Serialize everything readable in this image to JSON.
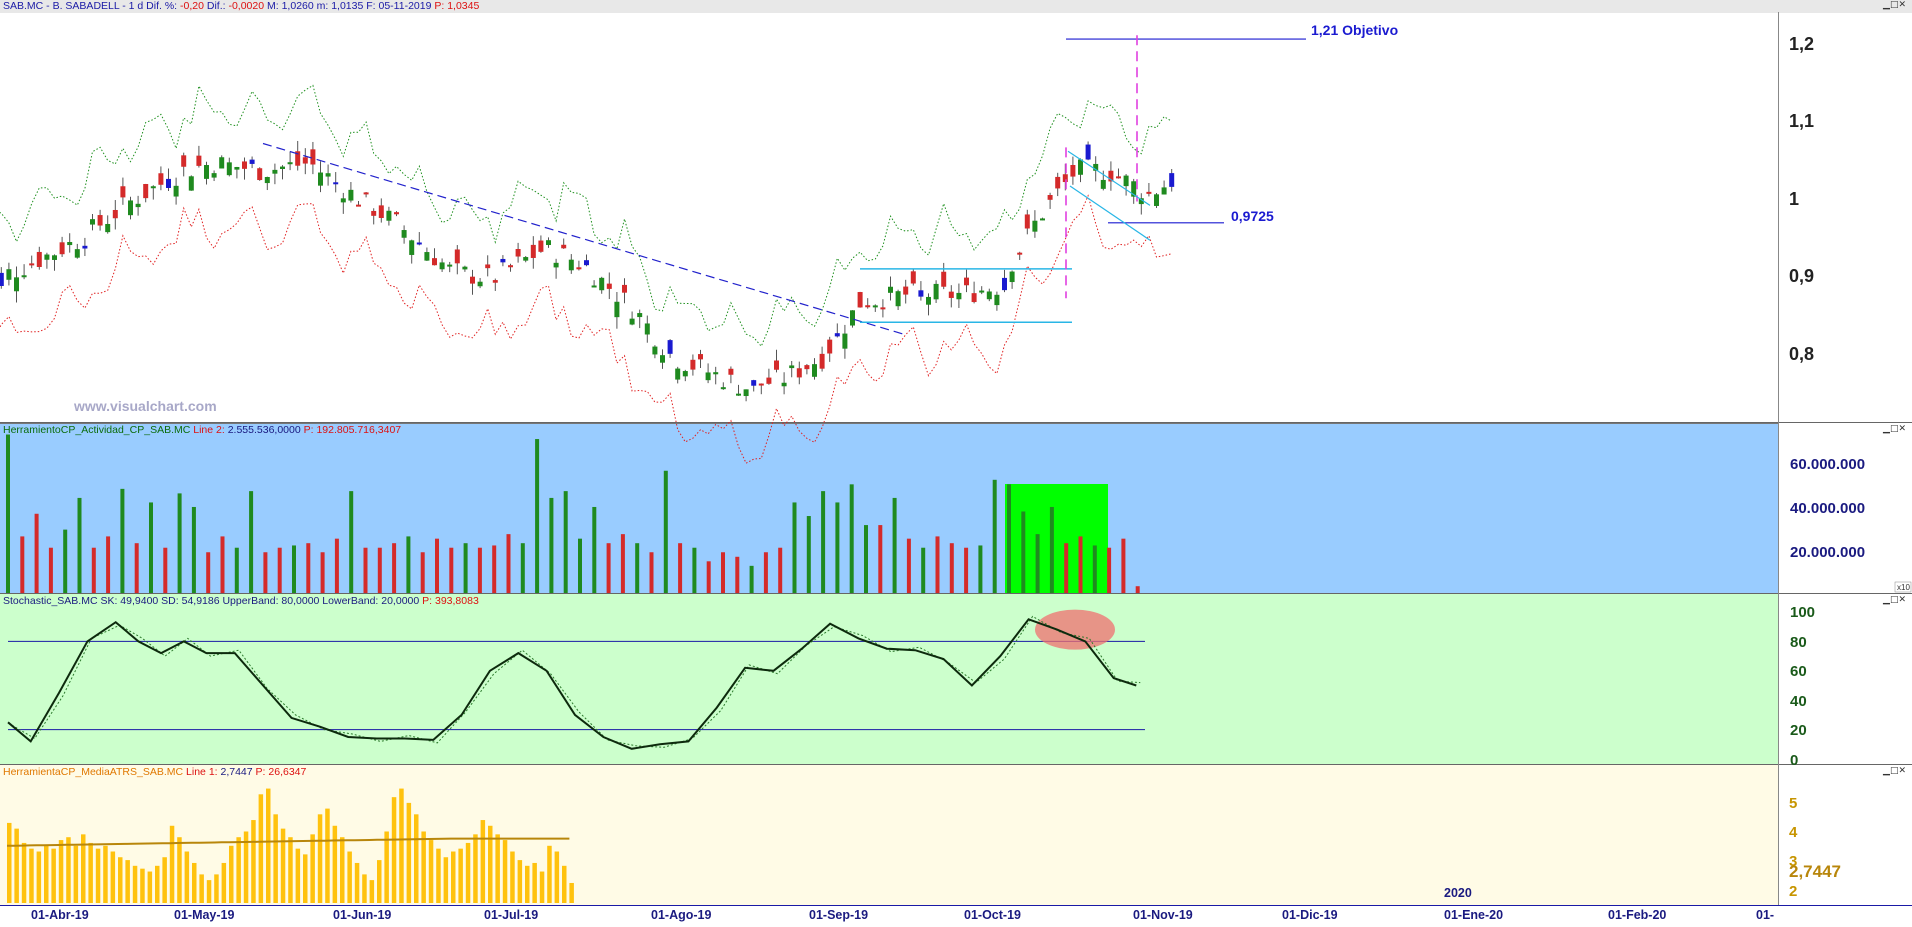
{
  "colors": {
    "up": "#1f8a1f",
    "down": "#d42a2a",
    "blue_candle": "#1a1ad0",
    "volume_bg": "#99ccff",
    "stoch_bg": "#ccffcc",
    "atr_bg": "#fffbe6",
    "atr_bar": "#ffc20e",
    "upper_band": "#1d8f1d",
    "lower_band": "#e02020"
  },
  "panel_main": {
    "title_parts": {
      "symbol": "SAB.MC - B. SABADELL -  1 d  Dif. %:",
      "dif_pct": "-0,20",
      "dif_label": "Dif.:",
      "dif": "-0,0020",
      "rest": "M: 1,0260  m: 1,0135  F: 05-11-2019",
      "p_label": "P:",
      "p_value": "1,0345"
    },
    "watermark": "www.visualchart.com",
    "annotations": {
      "objetivo": "1,21 Objetivo",
      "support": "0,9725"
    }
  },
  "panel_volume": {
    "name": "HerramientoCP_Actividad_CP_SAB.MC",
    "line_label": "Line 2:",
    "line_value": "2.555.536,0000",
    "p_label": "P:",
    "p_value": "192.805.716,3407",
    "axis_badge": "x10"
  },
  "panel_stoch": {
    "name": "Stochastic_SAB.MC",
    "values": "SK: 49,9400  SD: 54,9186  UpperBand: 80,0000  LowerBand: 20,0000",
    "p_label": "P:",
    "p_value": "393,8083"
  },
  "panel_atr": {
    "name": "HerramientaCP_MediaATRS_SAB.MC",
    "line_label": "Line 1:",
    "line_value": "2,7447",
    "p_label": "P:",
    "p_value": "26,6347",
    "last_value": "2,7447"
  },
  "x_axis": {
    "labels": [
      "01-Abr-19",
      "01-May-19",
      "01-Jun-19",
      "01-Jul-19",
      "01-Ago-19",
      "01-Sep-19",
      "01-Oct-19",
      "01-Nov-19",
      "01-Dic-19",
      "01-Ene-20",
      "01-Feb-20",
      "01-"
    ],
    "year_label": "2020"
  },
  "chart_data": [
    {
      "type": "candlestick",
      "title": "SAB.MC - B. SABADELL - 1 d",
      "y_ticks": [
        0.8,
        0.9,
        1.0,
        1.1,
        1.2
      ],
      "y_tick_labels": [
        "0,8",
        "0,9",
        "1",
        "1,1",
        "1,2"
      ],
      "ylim": [
        0.715,
        1.245
      ],
      "x_range": [
        "2019-03-22",
        "2019-11-05"
      ],
      "series_points_close": [
        [
          "2019-03-22",
          0.89
        ],
        [
          "2019-04-01",
          0.92
        ],
        [
          "2019-04-10",
          0.95
        ],
        [
          "2019-04-20",
          1.0
        ],
        [
          "2019-04-30",
          1.04
        ],
        [
          "2019-05-06",
          1.05
        ],
        [
          "2019-05-15",
          1.04
        ],
        [
          "2019-05-24",
          1.05
        ],
        [
          "2019-06-01",
          1.01
        ],
        [
          "2019-06-10",
          0.97
        ],
        [
          "2019-06-20",
          0.91
        ],
        [
          "2019-06-28",
          0.9
        ],
        [
          "2019-07-08",
          0.94
        ],
        [
          "2019-07-15",
          0.92
        ],
        [
          "2019-07-25",
          0.86
        ],
        [
          "2019-08-01",
          0.8
        ],
        [
          "2019-08-08",
          0.78
        ],
        [
          "2019-08-15",
          0.76
        ],
        [
          "2019-08-22",
          0.77
        ],
        [
          "2019-08-30",
          0.8
        ],
        [
          "2019-09-06",
          0.87
        ],
        [
          "2019-09-15",
          0.88
        ],
        [
          "2019-09-25",
          0.88
        ],
        [
          "2019-10-02",
          0.89
        ],
        [
          "2019-10-10",
          0.98
        ],
        [
          "2019-10-17",
          1.04
        ],
        [
          "2019-10-23",
          1.04
        ],
        [
          "2019-10-31",
          1.01
        ],
        [
          "2019-11-05",
          1.03
        ]
      ],
      "annotations": [
        {
          "text": "1,21 Objetivo",
          "y": 1.21
        },
        {
          "text": "0,9725",
          "y": 0.9725
        }
      ]
    },
    {
      "type": "bar",
      "title": "HerramientoCP_Actividad_CP_SAB.MC",
      "y_tick_labels": [
        "20.000.000",
        "40.000.000",
        "60.000.000"
      ],
      "ylim": [
        0,
        72000000
      ],
      "values_approx": [
        70000000,
        25000000,
        35000000,
        20000000,
        28000000,
        42000000,
        20000000,
        25000000,
        46000000,
        22000000,
        40000000,
        20000000,
        44000000,
        38000000,
        18000000,
        25000000,
        20000000,
        45000000,
        18000000,
        20000000,
        21000000,
        22000000,
        18000000,
        24000000,
        45000000,
        20000000,
        20000000,
        22000000,
        25000000,
        18000000,
        24000000,
        20000000,
        22000000,
        20000000,
        21000000,
        26000000,
        22000000,
        68000000,
        42000000,
        45000000,
        24000000,
        38000000,
        22000000,
        26000000,
        22000000,
        18000000,
        54000000,
        22000000,
        20000000,
        14000000,
        18000000,
        16000000,
        12000000,
        18000000,
        20000000,
        40000000,
        34000000,
        45000000,
        40000000,
        48000000,
        30000000,
        30000000,
        42000000,
        24000000,
        20000000,
        25000000,
        22000000,
        20000000,
        21000000,
        50000000,
        48000000,
        36000000,
        26000000,
        38000000,
        22000000,
        25000000,
        21000000,
        20000000,
        24000000,
        3000000
      ]
    },
    {
      "type": "line",
      "title": "Stochastic_SAB.MC",
      "y_ticks": [
        0,
        20,
        40,
        60,
        80,
        100
      ],
      "ylim": [
        -2,
        102
      ],
      "bands": [
        80,
        20
      ],
      "series": [
        {
          "name": "SK",
          "points": [
            [
              0,
              25
            ],
            [
              4,
              12
            ],
            [
              9,
              45
            ],
            [
              14,
              80
            ],
            [
              19,
              93
            ],
            [
              23,
              80
            ],
            [
              27,
              72
            ],
            [
              31,
              80
            ],
            [
              35,
              72
            ],
            [
              40,
              72
            ],
            [
              45,
              50
            ],
            [
              50,
              28
            ],
            [
              55,
              22
            ],
            [
              60,
              15
            ],
            [
              65,
              14
            ],
            [
              70,
              14
            ],
            [
              75,
              13
            ],
            [
              80,
              30
            ],
            [
              85,
              60
            ],
            [
              90,
              72
            ],
            [
              95,
              60
            ],
            [
              100,
              30
            ],
            [
              105,
              15
            ],
            [
              110,
              7
            ],
            [
              115,
              10
            ],
            [
              120,
              12
            ],
            [
              125,
              35
            ],
            [
              130,
              62
            ],
            [
              135,
              60
            ],
            [
              140,
              75
            ],
            [
              145,
              92
            ],
            [
              150,
              82
            ],
            [
              155,
              75
            ],
            [
              160,
              74
            ],
            [
              165,
              68
            ],
            [
              170,
              50
            ],
            [
              175,
              70
            ],
            [
              180,
              95
            ],
            [
              185,
              88
            ],
            [
              190,
              80
            ],
            [
              195,
              55
            ],
            [
              199,
              50
            ]
          ]
        }
      ]
    },
    {
      "type": "bar",
      "title": "HerramientaCP_MediaATRS_SAB.MC",
      "y_ticks": [
        2,
        3,
        4,
        5
      ],
      "ylim": [
        1.5,
        5.8
      ],
      "values_approx": [
        4.3,
        4.1,
        3.6,
        3.4,
        3.3,
        3.5,
        3.4,
        3.7,
        3.8,
        3.5,
        3.9,
        3.6,
        3.4,
        3.5,
        3.3,
        3.1,
        3.0,
        2.8,
        2.7,
        2.6,
        2.8,
        3.1,
        4.2,
        3.8,
        3.3,
        2.9,
        2.5,
        2.3,
        2.5,
        2.9,
        3.5,
        3.8,
        4.0,
        4.4,
        5.3,
        5.5,
        4.6,
        4.1,
        3.8,
        3.4,
        3.2,
        3.9,
        4.6,
        4.8,
        4.2,
        3.8,
        3.3,
        2.9,
        2.5,
        2.3,
        3.0,
        4.0,
        5.2,
        5.5,
        5.0,
        4.6,
        4.0,
        3.7,
        3.4,
        3.1,
        3.3,
        3.4,
        3.6,
        3.9,
        4.4,
        4.2,
        3.9,
        3.7,
        3.3,
        3.0,
        2.8,
        2.9,
        2.6,
        3.5,
        3.3,
        2.8,
        2.2
      ]
    }
  ]
}
